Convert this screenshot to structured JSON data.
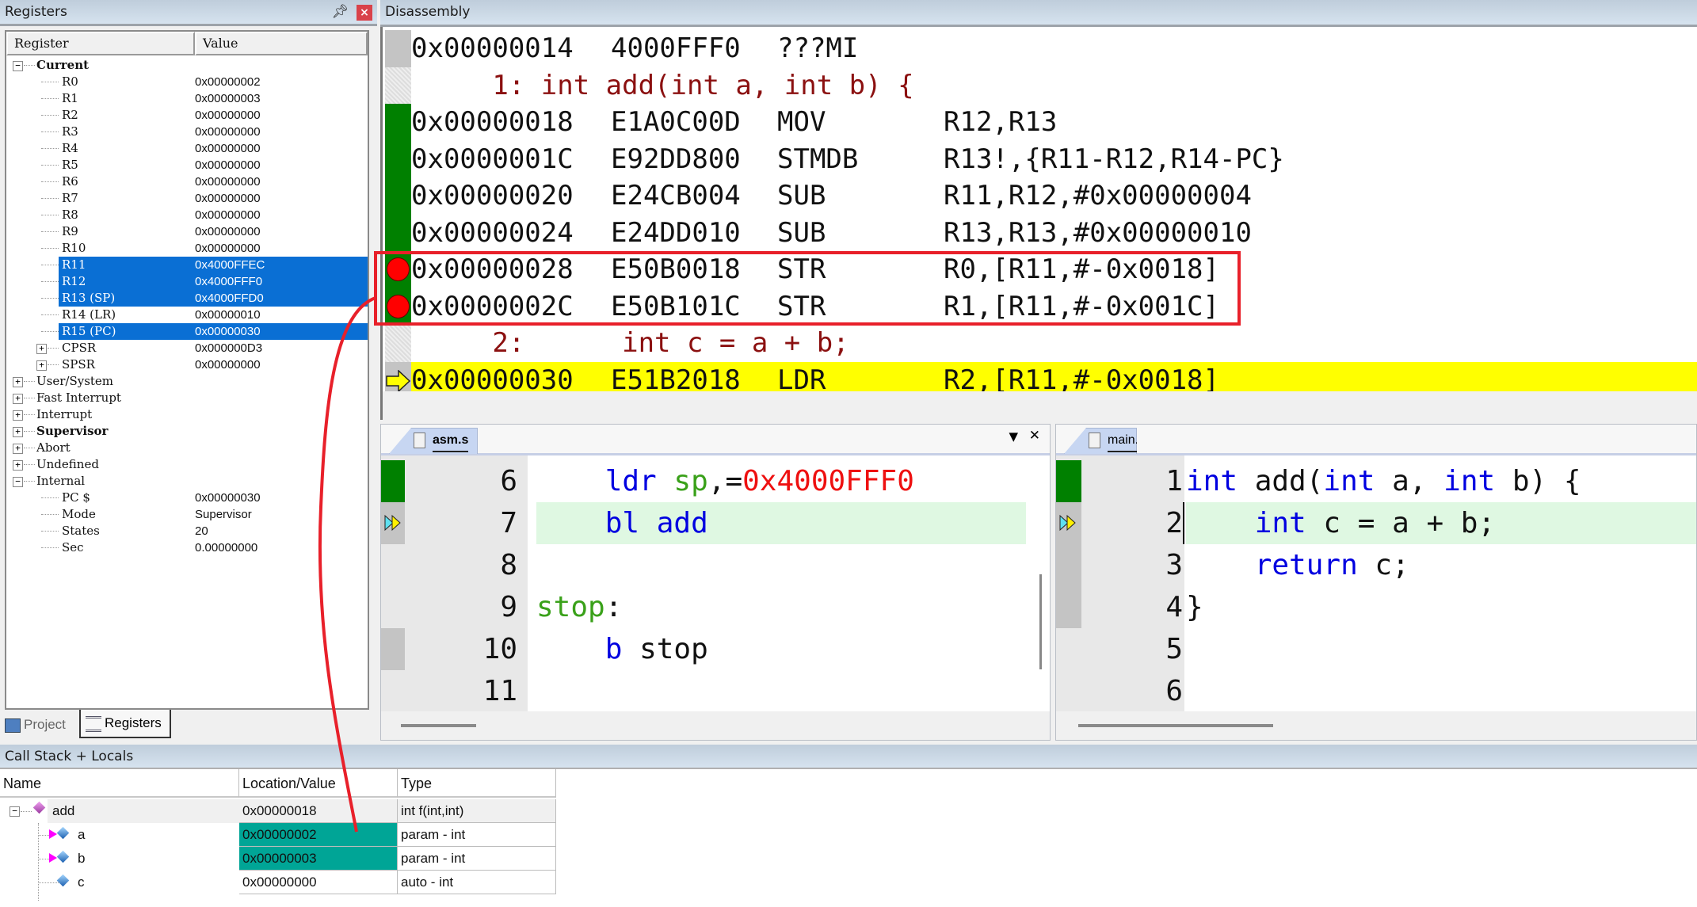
{
  "registers": {
    "title": "Registers",
    "col_register": "Register",
    "col_value": "Value",
    "groups": [
      {
        "label": "Current",
        "expanded": "−"
      },
      {
        "label": "User/System",
        "expanded": "+"
      },
      {
        "label": "Fast Interrupt",
        "expanded": "+"
      },
      {
        "label": "Interrupt",
        "expanded": "+"
      },
      {
        "label": "Supervisor",
        "expanded": "+"
      },
      {
        "label": "Abort",
        "expanded": "+"
      },
      {
        "label": "Undefined",
        "expanded": "+"
      },
      {
        "label": "Internal",
        "expanded": "−"
      }
    ],
    "current": [
      {
        "name": "R0",
        "value": "0x00000002"
      },
      {
        "name": "R1",
        "value": "0x00000003"
      },
      {
        "name": "R2",
        "value": "0x00000000"
      },
      {
        "name": "R3",
        "value": "0x00000000"
      },
      {
        "name": "R4",
        "value": "0x00000000"
      },
      {
        "name": "R5",
        "value": "0x00000000"
      },
      {
        "name": "R6",
        "value": "0x00000000"
      },
      {
        "name": "R7",
        "value": "0x00000000"
      },
      {
        "name": "R8",
        "value": "0x00000000"
      },
      {
        "name": "R9",
        "value": "0x00000000"
      },
      {
        "name": "R10",
        "value": "0x00000000"
      },
      {
        "name": "R11",
        "value": "0x4000FFEC",
        "selected": true
      },
      {
        "name": "R12",
        "value": "0x4000FFF0",
        "selected": true
      },
      {
        "name": "R13 (SP)",
        "value": "0x4000FFD0",
        "selected": true
      },
      {
        "name": "R14 (LR)",
        "value": "0x00000010"
      },
      {
        "name": "R15 (PC)",
        "value": "0x00000030",
        "selected": true
      },
      {
        "name": "CPSR",
        "value": "0x000000D3"
      },
      {
        "name": "SPSR",
        "value": "0x00000000"
      }
    ],
    "internal": [
      {
        "name": "PC  $",
        "value": "0x00000030"
      },
      {
        "name": "Mode",
        "value": "Supervisor"
      },
      {
        "name": "States",
        "value": "20"
      },
      {
        "name": "Sec",
        "value": "0.00000000"
      }
    ],
    "expander_plus": "+"
  },
  "left_tabs": {
    "project": "Project",
    "registers": "Registers"
  },
  "disassembly": {
    "title": "Disassembly",
    "rows": [
      {
        "addr": "0x00000014",
        "opcode": "4000FFF0",
        "mnemonic": "???MI",
        "args": ""
      },
      {
        "source": "     1: int add(int a, int b) {"
      },
      {
        "addr": "0x00000018",
        "opcode": "E1A0C00D",
        "mnemonic": "MOV",
        "args": "R12,R13"
      },
      {
        "addr": "0x0000001C",
        "opcode": "E92DD800",
        "mnemonic": "STMDB",
        "args": "R13!,{R11-R12,R14-PC}"
      },
      {
        "addr": "0x00000020",
        "opcode": "E24CB004",
        "mnemonic": "SUB",
        "args": "R11,R12,#0x00000004"
      },
      {
        "addr": "0x00000024",
        "opcode": "E24DD010",
        "mnemonic": "SUB",
        "args": "R13,R13,#0x00000010"
      },
      {
        "addr": "0x00000028",
        "opcode": "E50B0018",
        "mnemonic": "STR",
        "args": "R0,[R11,#-0x0018]",
        "breakpoint": true
      },
      {
        "addr": "0x0000002C",
        "opcode": "E50B101C",
        "mnemonic": "STR",
        "args": "R1,[R11,#-0x001C]",
        "breakpoint": true
      },
      {
        "source": "     2:      int c = a + b;"
      },
      {
        "addr": "0x00000030",
        "opcode": "E51B2018",
        "mnemonic": "LDR",
        "args": "R2,[R11,#-0x0018]",
        "current": true
      }
    ]
  },
  "asm_editor": {
    "tab": "asm.s",
    "dropdown": "▼",
    "close": "✕",
    "lines": [
      {
        "n": "6",
        "parts": [
          [
            "",
            "    "
          ],
          [
            "kw",
            "ldr "
          ],
          [
            "lbl-g",
            "sp"
          ],
          [
            "",
            ",="
          ],
          [
            "num-r",
            "0x4000FFF0"
          ]
        ]
      },
      {
        "n": "7",
        "parts": [
          [
            "",
            "    "
          ],
          [
            "kw",
            "bl add"
          ]
        ],
        "current": true
      },
      {
        "n": "8",
        "parts": []
      },
      {
        "n": "9",
        "parts": [
          [
            "lbl-g",
            "stop"
          ],
          [
            "",
            ":"
          ]
        ]
      },
      {
        "n": "10",
        "parts": [
          [
            "",
            "    "
          ],
          [
            "kw",
            "b"
          ],
          [
            "",
            " stop"
          ]
        ]
      },
      {
        "n": "11",
        "parts": []
      }
    ]
  },
  "c_editor": {
    "tab": "main.c",
    "lines": [
      {
        "n": "1",
        "parts": [
          [
            "kw",
            "int"
          ],
          [
            "",
            " add("
          ],
          [
            "kw",
            "int"
          ],
          [
            "",
            " a, "
          ],
          [
            "kw",
            "int"
          ],
          [
            "",
            " b) {"
          ]
        ]
      },
      {
        "n": "2",
        "parts": [
          [
            "",
            "    "
          ],
          [
            "kw",
            "int"
          ],
          [
            "",
            " c = a + b;"
          ]
        ],
        "current": true
      },
      {
        "n": "3",
        "parts": [
          [
            "",
            "    "
          ],
          [
            "kw",
            "return"
          ],
          [
            "",
            " c;"
          ]
        ]
      },
      {
        "n": "4",
        "parts": [
          [
            "",
            "}"
          ]
        ]
      },
      {
        "n": "5",
        "parts": []
      },
      {
        "n": "6",
        "parts": []
      }
    ]
  },
  "callstack": {
    "title": "Call Stack + Locals",
    "columns": [
      "Name",
      "Location/Value",
      "Type"
    ],
    "rows": [
      {
        "name": "add",
        "value": "0x00000018",
        "type": "int f(int,int)",
        "kind": "function"
      },
      {
        "name": "a",
        "value": "0x00000002",
        "type": "param - int",
        "kind": "param",
        "changed": true
      },
      {
        "name": "b",
        "value": "0x00000003",
        "type": "param - int",
        "kind": "param",
        "changed": true
      },
      {
        "name": "c",
        "value": "0x00000000",
        "type": "auto - int",
        "kind": "auto"
      }
    ]
  },
  "colors": {
    "selection": "#0a6fd4",
    "executed": "#008000",
    "current_line": "#ffff00",
    "breakpoint": "#ff0000",
    "changed_value": "#00a596",
    "annotation": "#e8202a"
  }
}
